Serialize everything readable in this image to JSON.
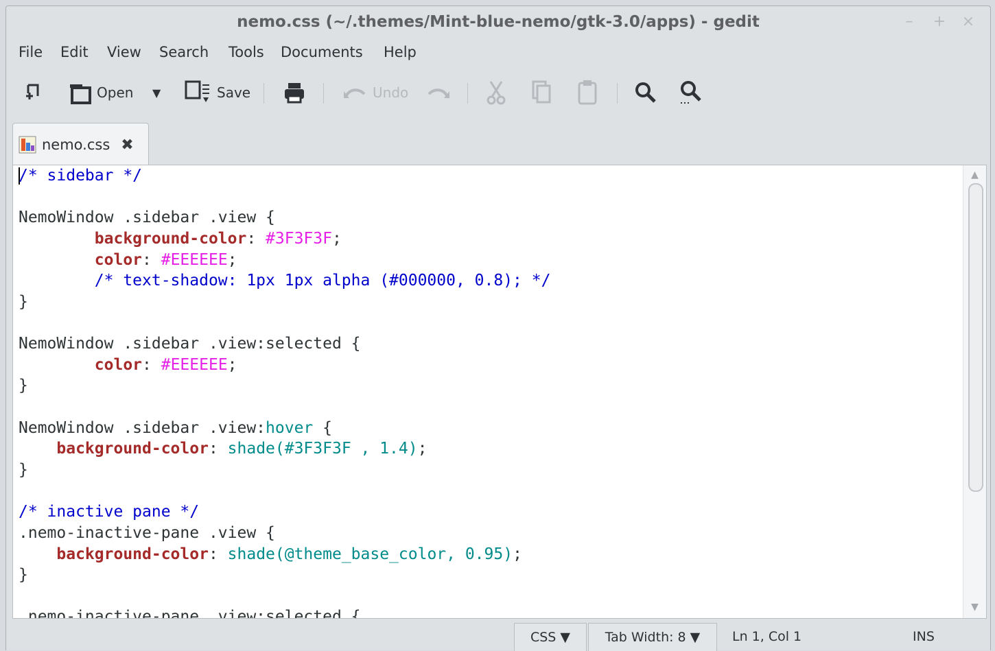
{
  "window": {
    "title": "nemo.css (~/.themes/Mint-blue-nemo/gtk-3.0/apps) - gedit",
    "controls": {
      "minimize": "–",
      "maximize": "+",
      "close": "×"
    }
  },
  "menu": [
    "File",
    "Edit",
    "View",
    "Search",
    "Tools",
    "Documents",
    "Help"
  ],
  "toolbar": {
    "new_icon": "new-document-icon",
    "open_label": "Open",
    "open_dropdown": "▼",
    "save_label": "Save",
    "print_icon": "print-icon",
    "undo_label": "Undo",
    "redo_icon": "redo-icon",
    "cut_icon": "cut-icon",
    "copy_icon": "copy-icon",
    "paste_icon": "paste-icon",
    "find_icon": "search-icon",
    "replace_icon": "search-replace-icon"
  },
  "tabs": [
    {
      "label": "nemo.css",
      "close": "✖",
      "icon": "css-file-icon"
    }
  ],
  "editor": {
    "lines": [
      [
        [
          "c-comment",
          "/* sidebar */"
        ]
      ],
      [],
      [
        [
          "",
          "NemoWindow .sidebar .view {"
        ]
      ],
      [
        [
          "",
          "        "
        ],
        [
          "c-prop",
          "background-color"
        ],
        [
          "",
          ": "
        ],
        [
          "c-value",
          "#3F3F3F"
        ],
        [
          "",
          ";"
        ]
      ],
      [
        [
          "",
          "        "
        ],
        [
          "c-prop",
          "color"
        ],
        [
          "",
          ": "
        ],
        [
          "c-value",
          "#EEEEEE"
        ],
        [
          "",
          ";"
        ]
      ],
      [
        [
          "",
          "        "
        ],
        [
          "c-comment",
          "/* text-shadow: 1px 1px alpha (#000000, 0.8); */"
        ]
      ],
      [
        [
          "",
          "}"
        ]
      ],
      [],
      [
        [
          "",
          "NemoWindow .sidebar .view:selected {"
        ]
      ],
      [
        [
          "",
          "        "
        ],
        [
          "c-prop",
          "color"
        ],
        [
          "",
          ": "
        ],
        [
          "c-value",
          "#EEEEEE"
        ],
        [
          "",
          ";"
        ]
      ],
      [
        [
          "",
          "}"
        ]
      ],
      [],
      [
        [
          "",
          "NemoWindow .sidebar .view:"
        ],
        [
          "c-pseudo",
          "hover"
        ],
        [
          "",
          " {"
        ]
      ],
      [
        [
          "",
          "    "
        ],
        [
          "c-prop",
          "background-color"
        ],
        [
          "",
          ": "
        ],
        [
          "c-func",
          "shade(#3F3F3F , 1.4)"
        ],
        [
          "",
          ";"
        ]
      ],
      [
        [
          "",
          "}"
        ]
      ],
      [],
      [
        [
          "c-comment",
          "/* inactive pane */"
        ]
      ],
      [
        [
          "",
          ".nemo-inactive-pane .view {"
        ]
      ],
      [
        [
          "",
          "    "
        ],
        [
          "c-prop",
          "background-color"
        ],
        [
          "",
          ": "
        ],
        [
          "c-func",
          "shade(@theme_base_color, 0.95)"
        ],
        [
          "",
          ";"
        ]
      ],
      [
        [
          "",
          "}"
        ]
      ],
      [],
      [
        [
          "",
          ".nemo-inactive-pane .view:selected {"
        ]
      ]
    ]
  },
  "statusbar": {
    "language": "CSS ▼",
    "tab_width": "Tab Width:  8  ▼",
    "position": "Ln 1, Col 1",
    "mode": "INS"
  }
}
